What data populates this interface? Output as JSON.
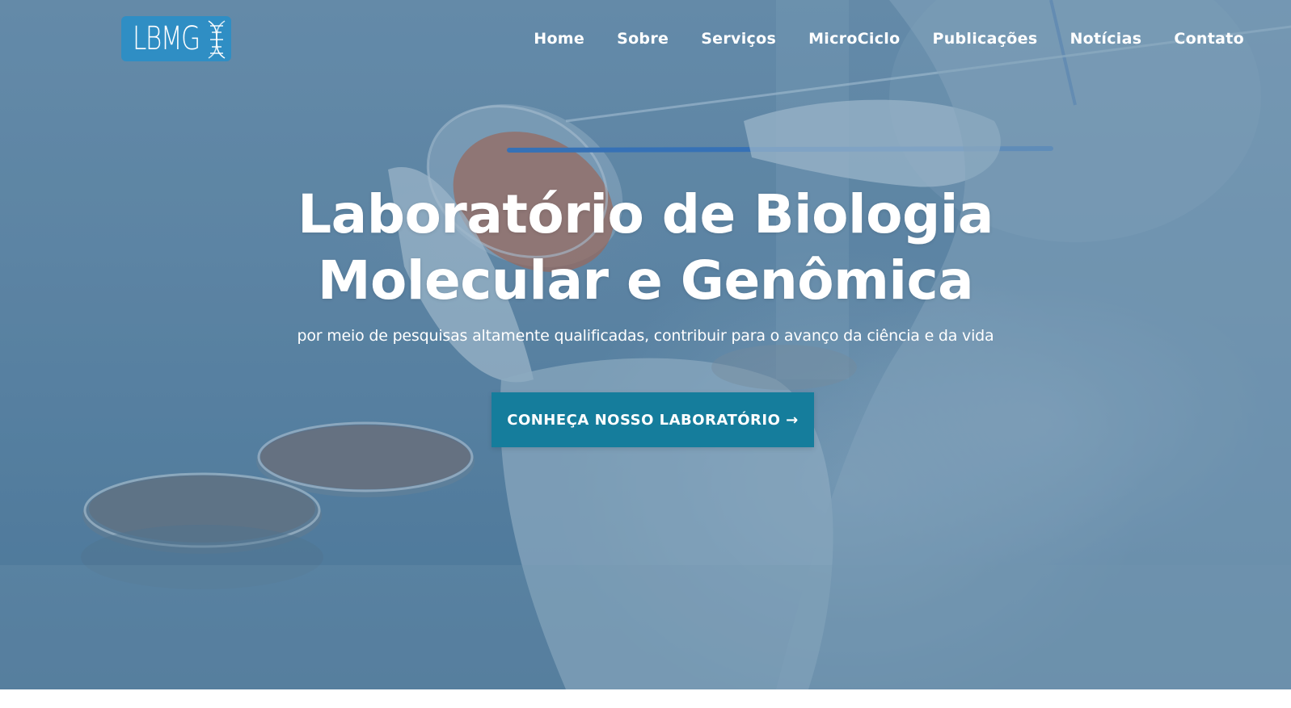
{
  "brand": {
    "logo_text": "LBMG",
    "logo_color": "#2f8ec4"
  },
  "nav": {
    "items": [
      {
        "label": "Home"
      },
      {
        "label": "Sobre"
      },
      {
        "label": "Serviços"
      },
      {
        "label": "MicroCiclo"
      },
      {
        "label": "Publicações"
      },
      {
        "label": "Notícias"
      },
      {
        "label": "Contato"
      }
    ]
  },
  "hero": {
    "title_line1": "Laboratório de Biologia",
    "title_line2": "Molecular e Genômica",
    "subtitle": "por meio de pesquisas altamente qualificadas, contribuir para o avanço da ciência e da vida",
    "cta_label": "CONHEÇA NOSSO LABORATÓRIO →",
    "cta_color": "#157d9c",
    "background_image": "laboratory-petri-dish-photo"
  }
}
